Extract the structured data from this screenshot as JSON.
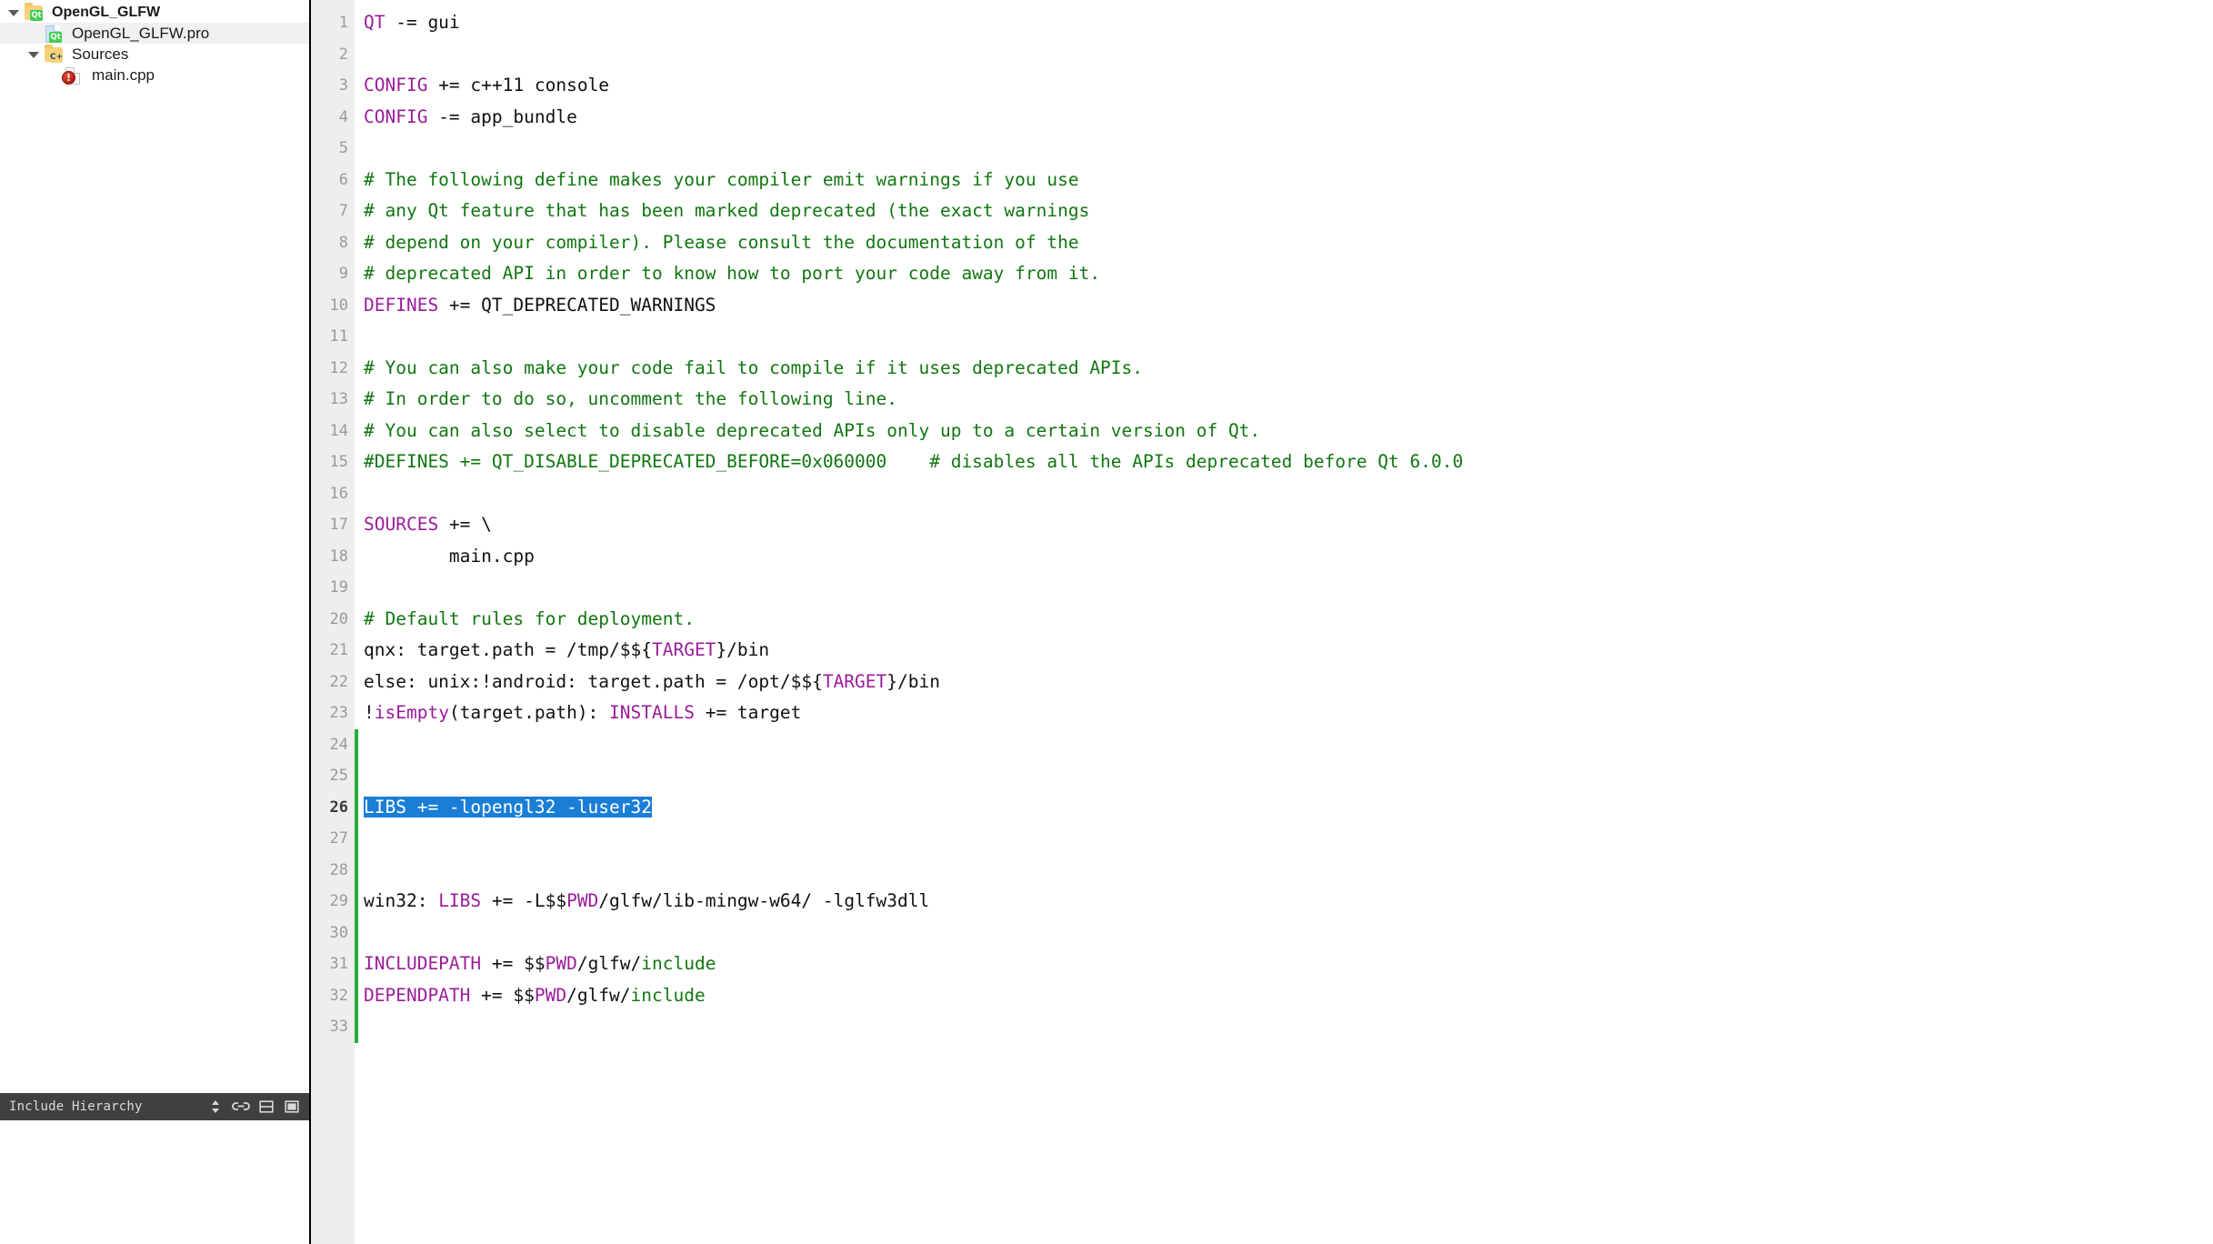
{
  "sidebar": {
    "tree": [
      {
        "label": "OpenGL_GLFW",
        "icon": "folder-qt-icon",
        "level": 0,
        "arrow": "down",
        "selected": false,
        "style": "bold"
      },
      {
        "label": "OpenGL_GLFW.pro",
        "icon": "file-qt-icon",
        "level": 1,
        "arrow": "none",
        "selected": true,
        "style": "big"
      },
      {
        "label": "Sources",
        "icon": "folder-cpp-icon",
        "level": 1,
        "arrow": "down",
        "selected": false,
        "style": "big"
      },
      {
        "label": "main.cpp",
        "icon": "file-error-icon",
        "level": 2,
        "arrow": "none",
        "selected": false,
        "style": "big"
      }
    ],
    "dock": {
      "title": "Include Hierarchy",
      "buttons": [
        {
          "name": "updown-arrows-icon",
          "glyph": "updown"
        },
        {
          "name": "link-icon",
          "glyph": "link"
        },
        {
          "name": "split-icon",
          "glyph": "split"
        },
        {
          "name": "close-panel-icon",
          "glyph": "close-panel"
        }
      ]
    }
  },
  "editor": {
    "current_line": 26,
    "colors": {
      "keyword": "#9b1c9b",
      "comment": "#117711",
      "selection": "#1a7ed6",
      "gutter_bg": "#eeeeee",
      "change_mark": "#2bad3c"
    },
    "changed_lines": [
      24,
      25,
      26,
      27,
      28,
      29,
      30,
      31,
      32,
      33
    ],
    "lines": [
      {
        "n": 1,
        "tokens": [
          {
            "t": "QT",
            "c": "kw"
          },
          {
            "t": " -= gui",
            "c": "pl"
          }
        ]
      },
      {
        "n": 2,
        "tokens": []
      },
      {
        "n": 3,
        "tokens": [
          {
            "t": "CONFIG",
            "c": "kw"
          },
          {
            "t": " += c++11 console",
            "c": "pl"
          }
        ]
      },
      {
        "n": 4,
        "tokens": [
          {
            "t": "CONFIG",
            "c": "kw"
          },
          {
            "t": " -= app_bundle",
            "c": "pl"
          }
        ]
      },
      {
        "n": 5,
        "tokens": []
      },
      {
        "n": 6,
        "tokens": [
          {
            "t": "# The following define makes your compiler emit warnings if you use",
            "c": "cm"
          }
        ]
      },
      {
        "n": 7,
        "tokens": [
          {
            "t": "# any Qt feature that has been marked deprecated (the exact warnings",
            "c": "cm"
          }
        ]
      },
      {
        "n": 8,
        "tokens": [
          {
            "t": "# depend on your compiler). Please consult the documentation of the",
            "c": "cm"
          }
        ]
      },
      {
        "n": 9,
        "tokens": [
          {
            "t": "# deprecated API in order to know how to port your code away from it.",
            "c": "cm"
          }
        ]
      },
      {
        "n": 10,
        "tokens": [
          {
            "t": "DEFINES",
            "c": "kw"
          },
          {
            "t": " += QT_DEPRECATED_WARNINGS",
            "c": "pl"
          }
        ]
      },
      {
        "n": 11,
        "tokens": []
      },
      {
        "n": 12,
        "tokens": [
          {
            "t": "# You can also make your code fail to compile if it uses deprecated APIs.",
            "c": "cm"
          }
        ]
      },
      {
        "n": 13,
        "tokens": [
          {
            "t": "# In order to do so, uncomment the following line.",
            "c": "cm"
          }
        ]
      },
      {
        "n": 14,
        "tokens": [
          {
            "t": "# You can also select to disable deprecated APIs only up to a certain version of Qt.",
            "c": "cm"
          }
        ]
      },
      {
        "n": 15,
        "tokens": [
          {
            "t": "#DEFINES += QT_DISABLE_DEPRECATED_BEFORE=0x060000    # disables all the APIs deprecated before Qt 6.0.0",
            "c": "cm"
          }
        ]
      },
      {
        "n": 16,
        "tokens": []
      },
      {
        "n": 17,
        "tokens": [
          {
            "t": "SOURCES",
            "c": "kw"
          },
          {
            "t": " += \\",
            "c": "pl"
          }
        ]
      },
      {
        "n": 18,
        "tokens": [
          {
            "t": "        main.cpp",
            "c": "pl"
          }
        ]
      },
      {
        "n": 19,
        "tokens": []
      },
      {
        "n": 20,
        "tokens": [
          {
            "t": "# Default rules for deployment.",
            "c": "cm"
          }
        ]
      },
      {
        "n": 21,
        "tokens": [
          {
            "t": "qnx: target.path = /tmp/$${",
            "c": "pl"
          },
          {
            "t": "TARGET",
            "c": "kw"
          },
          {
            "t": "}/bin",
            "c": "pl"
          }
        ]
      },
      {
        "n": 22,
        "tokens": [
          {
            "t": "else: unix:!android: target.path = /opt/$${",
            "c": "pl"
          },
          {
            "t": "TARGET",
            "c": "kw"
          },
          {
            "t": "}/bin",
            "c": "pl"
          }
        ]
      },
      {
        "n": 23,
        "tokens": [
          {
            "t": "!",
            "c": "pl"
          },
          {
            "t": "isEmpty",
            "c": "kw"
          },
          {
            "t": "(target.path): ",
            "c": "pl"
          },
          {
            "t": "INSTALLS",
            "c": "kw"
          },
          {
            "t": " += target",
            "c": "pl"
          }
        ]
      },
      {
        "n": 24,
        "tokens": []
      },
      {
        "n": 25,
        "tokens": []
      },
      {
        "n": 26,
        "tokens": [
          {
            "t": "LIBS += -lopengl32 -luser32",
            "c": "sel"
          }
        ]
      },
      {
        "n": 27,
        "tokens": []
      },
      {
        "n": 28,
        "tokens": []
      },
      {
        "n": 29,
        "tokens": [
          {
            "t": "win32: ",
            "c": "pl"
          },
          {
            "t": "LIBS",
            "c": "kw"
          },
          {
            "t": " += -L$$",
            "c": "pl"
          },
          {
            "t": "PWD",
            "c": "kw"
          },
          {
            "t": "/glfw/lib-mingw-w64/ -lglfw3dll",
            "c": "pl"
          }
        ]
      },
      {
        "n": 30,
        "tokens": []
      },
      {
        "n": 31,
        "tokens": [
          {
            "t": "INCLUDEPATH",
            "c": "kw"
          },
          {
            "t": " += $$",
            "c": "pl"
          },
          {
            "t": "PWD",
            "c": "kw"
          },
          {
            "t": "/glfw/",
            "c": "pl"
          },
          {
            "t": "include",
            "c": "cm"
          }
        ]
      },
      {
        "n": 32,
        "tokens": [
          {
            "t": "DEPENDPATH",
            "c": "kw"
          },
          {
            "t": " += $$",
            "c": "pl"
          },
          {
            "t": "PWD",
            "c": "kw"
          },
          {
            "t": "/glfw/",
            "c": "pl"
          },
          {
            "t": "include",
            "c": "cm"
          }
        ]
      },
      {
        "n": 33,
        "tokens": []
      }
    ]
  }
}
